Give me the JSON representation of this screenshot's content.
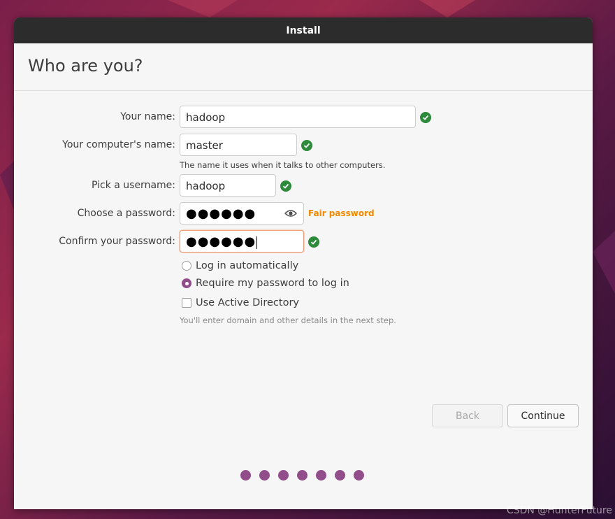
{
  "window": {
    "title": "Install"
  },
  "page": {
    "title": "Who are you?"
  },
  "form": {
    "your_name": {
      "label": "Your name:",
      "value": "hadoop"
    },
    "computer_name": {
      "label": "Your computer's name:",
      "value": "master",
      "hint": "The name it uses when it talks to other computers."
    },
    "username": {
      "label": "Pick a username:",
      "value": "hadoop"
    },
    "password": {
      "label": "Choose a password:",
      "value": "●●●●●●",
      "strength": "Fair password"
    },
    "confirm_password": {
      "label": "Confirm your password:",
      "value": "●●●●●●"
    }
  },
  "options": {
    "login_auto": {
      "label": "Log in automatically",
      "selected": false
    },
    "require_password": {
      "label": "Require my password to log in",
      "selected": true
    },
    "active_directory": {
      "label": "Use Active Directory",
      "checked": false,
      "hint": "You'll enter domain and other details in the next step."
    }
  },
  "buttons": {
    "back": "Back",
    "continue": "Continue"
  },
  "progress": {
    "total_steps": 7
  },
  "colors": {
    "accent": "#924d8b",
    "ok": "#2c8a3a",
    "warning": "#f08a00",
    "titlebar": "#2c2c2c"
  },
  "watermark": "CSDN @HunterFuture"
}
